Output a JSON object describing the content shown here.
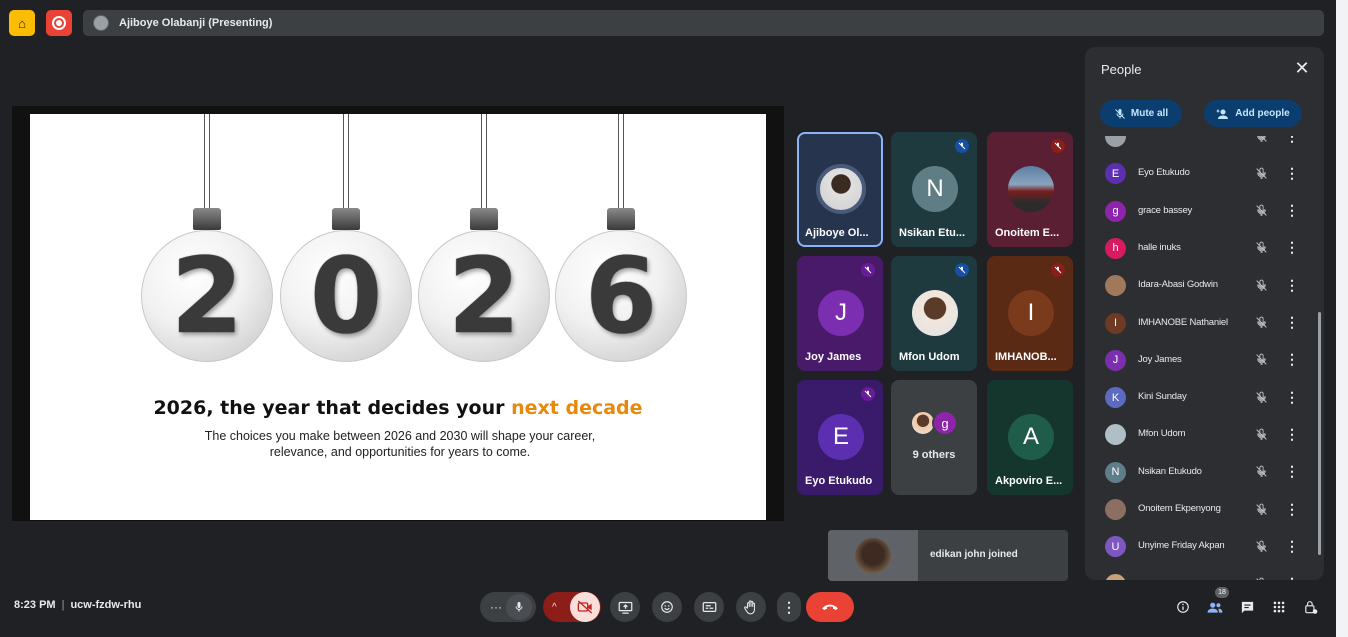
{
  "topbar": {
    "presenter_label": "Ajiboye Olabanji (Presenting)"
  },
  "slide": {
    "digits": [
      "2",
      "0",
      "2",
      "6"
    ],
    "title_main": "2026, the year that decides your ",
    "title_accent": "next decade",
    "subtitle": "The choices you make between 2026 and 2030 will shape your career, relevance, and opportunities for years to come.",
    "accent_color": "#e8890c"
  },
  "tiles": [
    {
      "name": "Ajiboye Ol...",
      "initial": "",
      "bg": "#26344e",
      "avatar": "photo",
      "selected": true
    },
    {
      "name": "Nsikan Etu...",
      "initial": "N",
      "bg": "#1e3a3f",
      "avatar_bg": "#5f7d84",
      "mic": "muted-blue"
    },
    {
      "name": "Onoitem E...",
      "initial": "",
      "bg": "#5a1f33",
      "avatar": "car",
      "mic": "muted-red"
    },
    {
      "name": "Joy James",
      "initial": "J",
      "bg": "#4a1a6a",
      "avatar_bg": "#7b2fb0",
      "mic": "muted-purple"
    },
    {
      "name": "Mfon Udom",
      "initial": "",
      "bg": "#1e3a3f",
      "avatar": "photo2",
      "mic": "muted-blue"
    },
    {
      "name": "IMHANOB...",
      "initial": "I",
      "bg": "#5a2a14",
      "avatar_bg": "#7a3a1c",
      "mic": "muted-red"
    },
    {
      "name": "Eyo Etukudo",
      "initial": "E",
      "bg": "#3a1a6a",
      "avatar_bg": "#5b2fb0",
      "mic": "muted-purple"
    },
    {
      "name": "9 others",
      "initial": "",
      "bg": "#3c4043",
      "avatar": "others"
    },
    {
      "name": "Akpoviro E...",
      "initial": "A",
      "bg": "#15362d",
      "avatar_bg": "#1f5c4a"
    }
  ],
  "toast": {
    "text": "edikan john joined"
  },
  "people": {
    "title": "People",
    "mute_all": "Mute all",
    "add_people": "Add people",
    "list": [
      {
        "name": "",
        "initial": "",
        "color": "#9aa0a6"
      },
      {
        "name": "Eyo Etukudo",
        "initial": "E",
        "color": "#5b2fb0"
      },
      {
        "name": "grace bassey",
        "initial": "g",
        "color": "#8e24aa"
      },
      {
        "name": "halle inuks",
        "initial": "h",
        "color": "#d81b60"
      },
      {
        "name": "Idara-Abasi Godwin",
        "initial": "",
        "color": "#a0785a"
      },
      {
        "name": "IMHANOBE Nathaniel",
        "initial": "I",
        "color": "#6d3a24"
      },
      {
        "name": "Joy James",
        "initial": "J",
        "color": "#7b2fb0"
      },
      {
        "name": "Kini Sunday",
        "initial": "K",
        "color": "#5c6bc0"
      },
      {
        "name": "Mfon Udom",
        "initial": "",
        "color": "#b0bec5"
      },
      {
        "name": "Nsikan Etukudo",
        "initial": "N",
        "color": "#607d8b"
      },
      {
        "name": "Onoitem Ekpenyong",
        "initial": "",
        "color": "#8d6e63"
      },
      {
        "name": "Unyime Friday Akpan",
        "initial": "U",
        "color": "#7e57c2"
      },
      {
        "name": "",
        "initial": "",
        "color": "#c9a27a"
      }
    ]
  },
  "bottombar": {
    "time": "8:23 PM",
    "meeting_code": "ucw-fzdw-rhu",
    "people_count": "18"
  }
}
